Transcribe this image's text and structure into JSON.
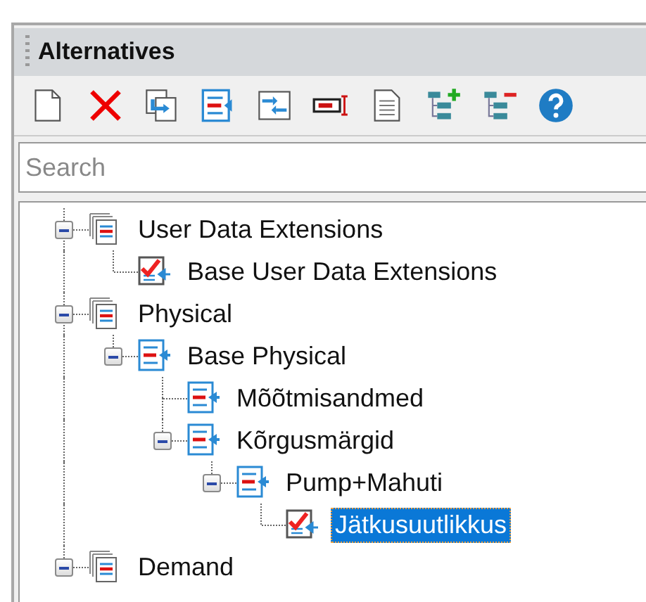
{
  "panel": {
    "title": "Alternatives"
  },
  "toolbar": [
    {
      "kind": "new"
    },
    {
      "kind": "delete"
    },
    {
      "kind": "copy"
    },
    {
      "kind": "base"
    },
    {
      "kind": "merge"
    },
    {
      "kind": "field"
    },
    {
      "kind": "text"
    },
    {
      "kind": "tree_add"
    },
    {
      "kind": "tree_remove"
    },
    {
      "kind": "help"
    }
  ],
  "search": {
    "placeholder": "Search"
  },
  "tree": [
    {
      "label": "User Data Extensions",
      "kind": "group",
      "expanded": true,
      "selected": false,
      "children": [
        {
          "label": "Base User Data Extensions",
          "kind": "check",
          "selected": false
        }
      ]
    },
    {
      "label": "Physical",
      "kind": "group",
      "expanded": true,
      "selected": false,
      "children": [
        {
          "label": "Base Physical",
          "kind": "base",
          "expanded": true,
          "selected": false,
          "children": [
            {
              "label": "Mõõtmisandmed",
              "kind": "base",
              "selected": false
            },
            {
              "label": "Kõrgusmärgid",
              "kind": "base",
              "expanded": true,
              "selected": false,
              "children": [
                {
                  "label": "Pump+Mahuti",
                  "kind": "base",
                  "expanded": true,
                  "selected": false,
                  "children": [
                    {
                      "label": "Jätkusuutlikkus",
                      "kind": "check",
                      "selected": true
                    }
                  ]
                }
              ]
            }
          ]
        }
      ]
    },
    {
      "label": "Demand",
      "kind": "group",
      "expanded": true,
      "selected": false
    }
  ]
}
